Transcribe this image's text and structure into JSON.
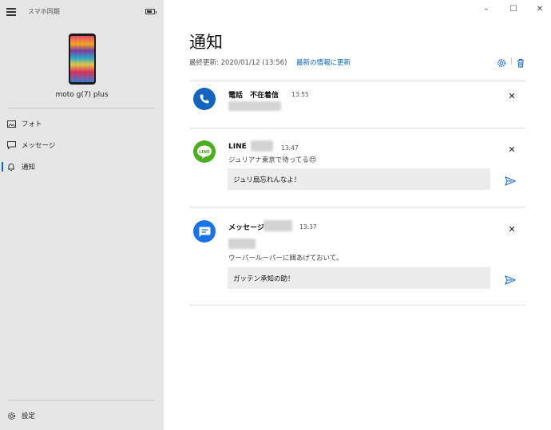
{
  "app": {
    "title": "スマホ同期"
  },
  "window_controls": {
    "minimize": "–",
    "maximize": "☐",
    "close": "✕"
  },
  "device": {
    "name": "moto g(7) plus",
    "battery_level": 0.7
  },
  "nav": [
    {
      "label": "フォト",
      "icon": "photo-icon"
    },
    {
      "label": "メッセージ",
      "icon": "message-icon"
    },
    {
      "label": "通知",
      "icon": "bell-icon"
    }
  ],
  "settings": {
    "label": "設定",
    "icon": "gear-icon"
  },
  "main": {
    "title": "通知",
    "last_updated": "最終更新: 2020/01/12 (13:56)",
    "refresh_label": "最新の情報に更新"
  },
  "notifications": [
    {
      "app": "電話　不在着信",
      "time": "13:55",
      "icon": "phone-icon",
      "accent": "#1565c0"
    },
    {
      "app": "LINE",
      "time": "13:47",
      "icon": "line-icon",
      "accent": "#4caf1f",
      "icon_label": "LINE",
      "message": "ジュリアナ東京で待ってる",
      "emoji": "😍",
      "reply": "ジュリ扇忘れんなよ！"
    },
    {
      "app": "メッセージ",
      "time": "13:37",
      "icon": "messages-icon",
      "accent": "#1a73e8",
      "message": "ウーパールーパーに餌あげておいて。",
      "reply": "ガッテン承知の助！"
    }
  ]
}
